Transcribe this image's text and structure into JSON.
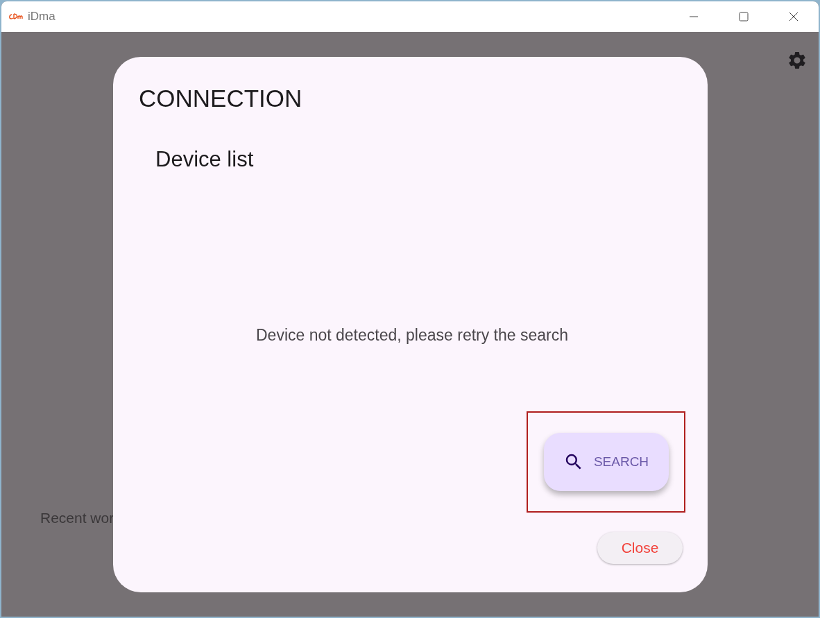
{
  "window": {
    "title": "iDma"
  },
  "background": {
    "recent_label": "Recent wor"
  },
  "dialog": {
    "title": "CONNECTION",
    "subtitle": "Device list",
    "message": "Device not detected, please retry the search",
    "search_button": {
      "label": "SEARCH",
      "highlighted": true
    },
    "close_button": {
      "label": "Close"
    }
  }
}
